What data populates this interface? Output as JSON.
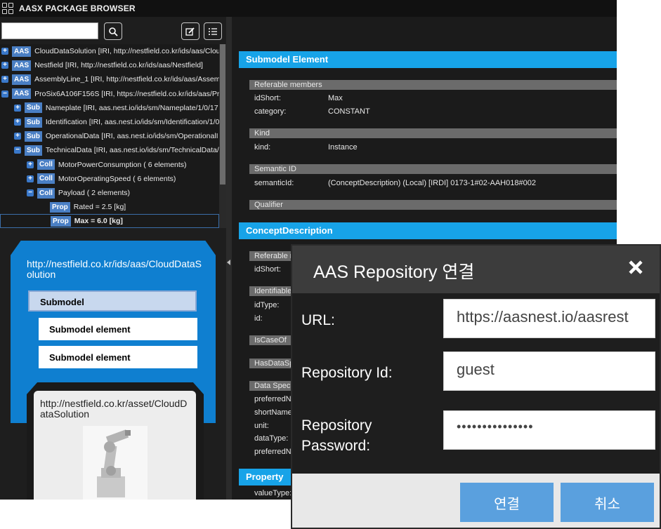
{
  "app": {
    "title": "AASX PACKAGE BROWSER"
  },
  "tree": [
    {
      "level": 0,
      "toggle": "+",
      "badge": "AAS",
      "text": "CloudDataSolution  [IRI, http://nestfield.co.kr/ids/aas/Clou"
    },
    {
      "level": 0,
      "toggle": "+",
      "badge": "AAS",
      "text": "Nestfield  [IRI, http://nestfield.co.kr/ids/aas/Nestfield]"
    },
    {
      "level": 0,
      "toggle": "+",
      "badge": "AAS",
      "text": "AssemblyLine_1  [IRI, http://nestfield.co.kr/ids/aas/Assemb"
    },
    {
      "level": 0,
      "toggle": "−",
      "badge": "AAS",
      "text": "ProSix6A106F156S  [IRI, https://nestfield.co.kr/ids/aas/Pro"
    },
    {
      "level": 1,
      "toggle": "+",
      "badge": "Sub",
      "text": "Nameplate  [IRI, aas.nest.io/ids/sm/Nameplate/1/0/17"
    },
    {
      "level": 1,
      "toggle": "+",
      "badge": "Sub",
      "text": "Identification  [IRI, aas.nest.io/ids/sm/Identification/1/0"
    },
    {
      "level": 1,
      "toggle": "+",
      "badge": "Sub",
      "text": "OperationalData  [IRI, aas.nest.io/ids/sm/OperationalI"
    },
    {
      "level": 1,
      "toggle": "−",
      "badge": "Sub",
      "text": "TechnicalData  [IRI, aas.nest.io/ids/sm/TechnicalData/"
    },
    {
      "level": 2,
      "toggle": "+",
      "badge": "Coll",
      "text": "MotorPowerConsumption   ( 6 elements)"
    },
    {
      "level": 2,
      "toggle": "+",
      "badge": "Coll",
      "text": "MotorOperatingSpeed   ( 6 elements)"
    },
    {
      "level": 2,
      "toggle": "−",
      "badge": "Coll",
      "text": "Payload   ( 2 elements)"
    },
    {
      "level": 3,
      "toggle": "",
      "badge": "Prop",
      "text": "Rated  =  2.5   [kg]"
    },
    {
      "level": 3,
      "toggle": "",
      "badge": "Prop",
      "text": "Max  =  6.0   [kg]",
      "selected": true
    }
  ],
  "graphic": {
    "aas_id": "http://nestfield.co.kr/ids/aas/CloudDataSolution",
    "submodel": "Submodel",
    "sme1": "Submodel element",
    "sme2": "Submodel element",
    "asset_id": "http://nestfield.co.kr/asset/CloudDataSolution"
  },
  "details": {
    "section1": "Submodel Element",
    "referable": "Referable members",
    "idShort_k": "idShort:",
    "idShort_v": "Max",
    "category_k": "category:",
    "category_v": "CONSTANT",
    "kind_h": "Kind",
    "kind_k": "kind:",
    "kind_v": "Instance",
    "semantic_h": "Semantic ID",
    "semantic_k": "semanticId:",
    "semantic_v": "(ConceptDescription) (Local) [IRDI] 0173-1#02-AAH018#002",
    "qualifier_h": "Qualifier",
    "section2": "ConceptDescription",
    "cd_referable": "Referable m",
    "cd_idShort": "idShort:",
    "identifiable": "Identifiable",
    "idType": "idType:",
    "id": "id:",
    "isCaseOf": "IsCaseOf",
    "hasDataSpec": "HasDataSp",
    "dataSpec": "Data Speci",
    "preferredN": "preferredN",
    "shortName": "shortName",
    "unit": "unit:",
    "dataType": "dataType:",
    "preferredN2": "preferredN",
    "section3": "Property",
    "valueType": "valueType:"
  },
  "dialog": {
    "title": "AAS Repository 연결",
    "url_label": "URL:",
    "url_value": "https://aasnest.io/aasrest",
    "repo_label": "Repository Id:",
    "repo_value": "guest",
    "pwd_label_1": "Repository",
    "pwd_label_2": "Password:",
    "pwd_value": "•••••••••••••••",
    "connect": "연결",
    "cancel": "취소"
  }
}
